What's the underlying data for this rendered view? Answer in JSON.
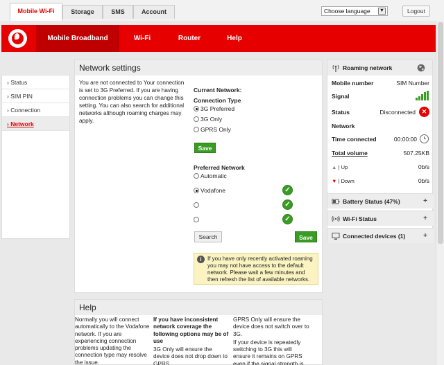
{
  "tabs": [
    "Mobile Wi-Fi",
    "Storage",
    "SMS",
    "Account"
  ],
  "language": {
    "selected": "Choose language"
  },
  "logout_label": "Logout",
  "nav": [
    "Mobile Broadband",
    "Wi-Fi",
    "Router",
    "Help"
  ],
  "sidebar": {
    "items": [
      "Status",
      "SIM PIN",
      "Connection",
      "Network"
    ]
  },
  "network": {
    "title": "Network settings",
    "intro": "You are not connected to Your connection is set to 3G Preferred. If you are having connection problems you can change this setting. You can also search for additional networks although roaming charges may apply.",
    "current_network_label": "Current Network:",
    "connection_type_label": "Connection Type",
    "connection_options": [
      "3G Preferred",
      "3G Only",
      "GPRS Only"
    ],
    "save_label": "Save",
    "preferred_label": "Preferred Network",
    "preferred_options": [
      "Automatic",
      "Vodafone",
      "",
      ""
    ],
    "search_label": "Search",
    "save2_label": "Save",
    "note": "If you have only recently activated roaming you may not have access to the default network. Please wait a few minutes and then refresh the list of available networks."
  },
  "help": {
    "title": "Help",
    "col1": "Normally you will connect automatically to the Vodafone network. If you are experiencing connection problems updating the connection type may resolve the issue.",
    "col2_bold": "If you have inconsistent network coverage the following options may be of use",
    "col2": "3G Only will ensure the device does not drop down to GPRS",
    "col3": "GPRS Only will ensure the device does not switch over to 3G.",
    "col3b": "If your device is repeatedly switching to 3G this will ensure it remains on GPRS even if the signal strength is"
  },
  "status_panel": {
    "title": "Roaming network",
    "mobile_number_label": "Mobile number",
    "mobile_number_value": "SIM Number",
    "signal_label": "Signal",
    "status_label": "Status",
    "status_value": "Disconnected",
    "network_label": "Network",
    "time_label": "Time connected",
    "time_value": "00:00:00",
    "total_volume_label": "Total volume",
    "total_volume_value": "507.25KB",
    "up_label": "| Up",
    "up_value": "0b/s",
    "down_label": "| Down",
    "down_value": "0b/s",
    "battery_label": "Battery Status (47%)",
    "wifi_label": "Wi-Fi Status",
    "devices_label": "Connected devices (1)",
    "colors": {
      "accent": "#e60000",
      "ok": "#3a9d23"
    }
  }
}
